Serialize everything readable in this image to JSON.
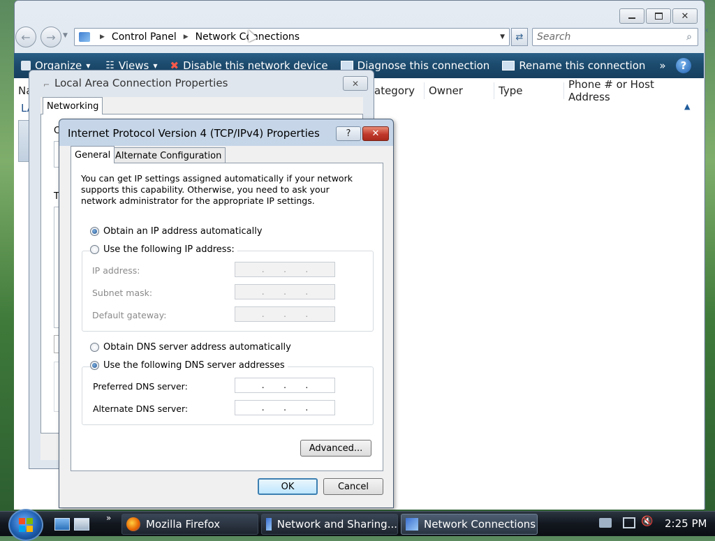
{
  "explorer": {
    "breadcrumb": [
      "Control Panel",
      "Network Connections"
    ],
    "search_placeholder": "Search",
    "commands": {
      "organize": "Organize",
      "views": "Views",
      "disable": "Disable this network device",
      "diagnose": "Diagnose this connection",
      "rename": "Rename this connection",
      "more": "»"
    },
    "columns": {
      "name": "Na",
      "category": "ategory",
      "owner": "Owner",
      "type": "Type",
      "phone": "Phone # or Host Address"
    },
    "list_item_partial": "LA"
  },
  "lac_dialog": {
    "title": "Local Area Connection Properties",
    "tab_networking": "Networking",
    "partial_c": "C",
    "partial_t": "T"
  },
  "ipv4_dialog": {
    "title": "Internet Protocol Version 4 (TCP/IPv4) Properties",
    "help": "?",
    "tabs": [
      "General",
      "Alternate Configuration"
    ],
    "intro": "You can get IP settings assigned automatically if your network supports this capability. Otherwise, you need to ask your network administrator for the appropriate IP settings.",
    "ip_auto": "Obtain an IP address automatically",
    "ip_manual": "Use the following IP address:",
    "ip_address_label": "IP address:",
    "subnet_label": "Subnet mask:",
    "gateway_label": "Default gateway:",
    "dns_auto": "Obtain DNS server address automatically",
    "dns_manual": "Use the following DNS server addresses",
    "preferred_dns_label": "Preferred DNS server:",
    "alternate_dns_label": "Alternate DNS server:",
    "dot": ".",
    "advanced_button": "Advanced...",
    "ok_button": "OK",
    "cancel_button": "Cancel",
    "ip_mode": "automatic",
    "dns_mode": "manual"
  },
  "taskbar": {
    "quick_more": "»",
    "tasks": [
      "Mozilla Firefox",
      "Network and Sharing...",
      "Network Connections"
    ],
    "active_task": "Network Connections",
    "clock": "2:25 PM"
  },
  "colors": {
    "command_bar": "#1c4b6e",
    "default_button_border": "#3c7fb1",
    "close_button": "#c0392b"
  }
}
